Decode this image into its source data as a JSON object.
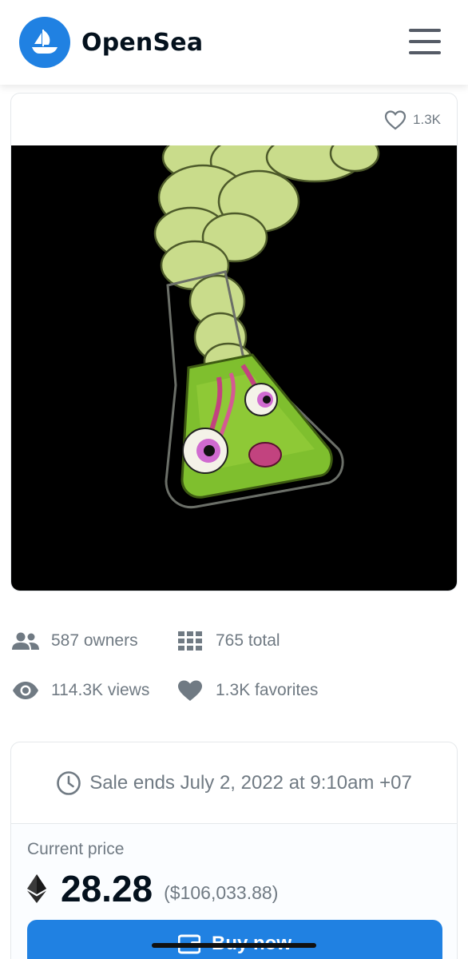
{
  "header": {
    "brand": "OpenSea",
    "menu_icon": "hamburger-menu-icon"
  },
  "asset": {
    "favorites_count": "1.3K",
    "image_alt": "green flask with eyeballs artwork"
  },
  "stats": {
    "owners": "587 owners",
    "total": "765 total",
    "views": "114.3K views",
    "favorites": "1.3K favorites"
  },
  "sale": {
    "ends_text": "Sale ends July 2, 2022 at 9:10am +07",
    "price_label": "Current price",
    "price_value": "28.28",
    "price_usd": "($106,033.88)",
    "buy_label": "Buy now"
  },
  "colors": {
    "accent": "#2081e2",
    "slime": "#c8dc8a",
    "liquid": "#7fbf2e"
  }
}
